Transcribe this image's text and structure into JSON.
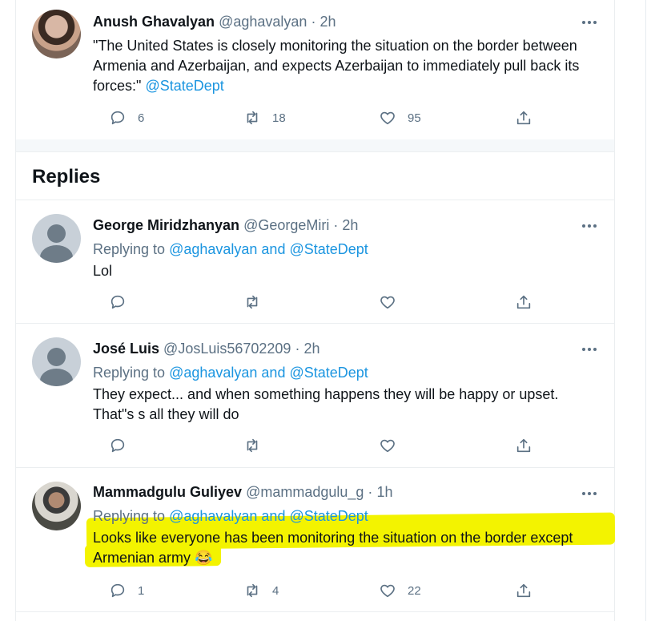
{
  "main_tweet": {
    "name": "Anush Ghavalyan",
    "handle": "@aghavalyan",
    "dot": "·",
    "time": "2h",
    "text": "\"The United States is closely monitoring the situation on the border between Armenia and Azerbaijan, and expects Azerbaijan to immediately pull back its forces:\"",
    "mention": "@StateDept",
    "reply_count": "6",
    "retweet_count": "18",
    "like_count": "95"
  },
  "replies_heading": "Replies",
  "replies": [
    {
      "name": "George Miridzhanyan",
      "handle": "@GeorgeMiri",
      "dot": "·",
      "time": "2h",
      "replying_prefix": "Replying to",
      "replying_to": "@aghavalyan and @StateDept",
      "text": "Lol",
      "reply_count": "",
      "retweet_count": "",
      "like_count": ""
    },
    {
      "name": "José Luis",
      "handle": "@JosLuis56702209",
      "dot": "·",
      "time": "2h",
      "replying_prefix": "Replying to",
      "replying_to": "@aghavalyan and @StateDept",
      "text_line1": "They expect... and when something happens they will be happy or upset.",
      "text_line2": "That\"s s all they will do",
      "reply_count": "",
      "retweet_count": "",
      "like_count": ""
    },
    {
      "name": "Mammadgulu Guliyev",
      "handle": "@mammadgulu_g",
      "dot": "·",
      "time": "1h",
      "replying_prefix": "Replying to",
      "replying_to": "@aghavalyan and @StateDept",
      "text_line1": "Looks like everyone has been monitoring the situation on the border except",
      "text_line2": "Armenian army",
      "emoji": "😂",
      "reply_count": "1",
      "retweet_count": "4",
      "like_count": "22"
    }
  ],
  "colors": {
    "accent": "#1b95e0",
    "secondary_text": "#5b7083",
    "highlight": "#f3f300"
  }
}
